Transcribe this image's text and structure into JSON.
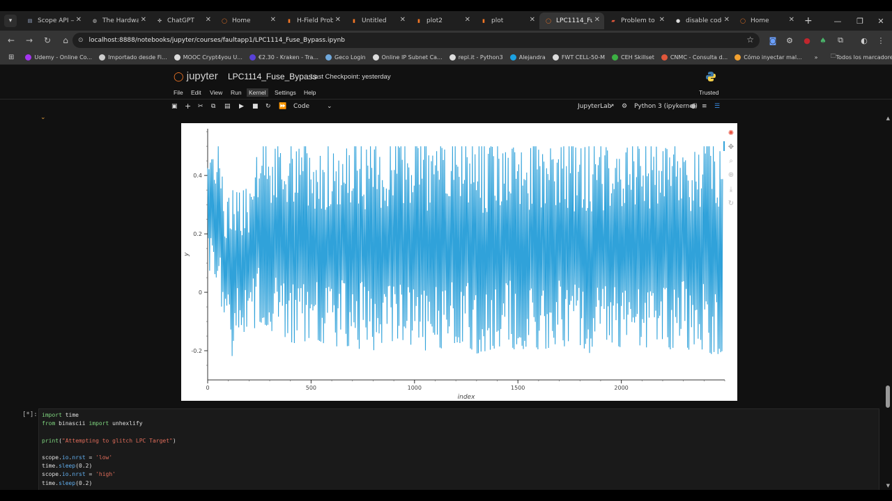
{
  "browser": {
    "tabs": [
      {
        "label": "Scope API —",
        "favicon": "doc-icon",
        "color": "#9aa7c7"
      },
      {
        "label": "The Hardwa",
        "favicon": "globe-icon",
        "color": "#cccccc"
      },
      {
        "label": "ChatGPT",
        "favicon": "chatgpt-icon",
        "color": "#dddddd"
      },
      {
        "label": "Home",
        "favicon": "jupyter-icon",
        "color": "#f37726"
      },
      {
        "label": "H-Field Prob",
        "favicon": "jupyter-book-icon",
        "color": "#f37726"
      },
      {
        "label": "Untitled",
        "favicon": "jupyter-book-icon",
        "color": "#f37726"
      },
      {
        "label": "plot2",
        "favicon": "jupyter-book-icon",
        "color": "#f37726"
      },
      {
        "label": "plot",
        "favicon": "jupyter-book-icon",
        "color": "#f37726"
      },
      {
        "label": "LPC1114_Fu",
        "favicon": "jupyter-icon",
        "color": "#f37726",
        "active": true
      },
      {
        "label": "Problem to",
        "favicon": "mail-icon",
        "color": "#e0573b"
      },
      {
        "label": "disable code",
        "favicon": "github-icon",
        "color": "#dddddd"
      },
      {
        "label": "Home",
        "favicon": "jupyter-icon",
        "color": "#f37726"
      }
    ],
    "url": "localhost:8888/notebooks/jupyter/courses/faultapp1/LPC1114_Fuse_Bypass.ipynb",
    "bookmarks": [
      {
        "label": "Udemy - Online Co...",
        "color": "#a435f0"
      },
      {
        "label": "Importado desde Fi...",
        "color": "#cccccc"
      },
      {
        "label": "MOOC Crypt4you U...",
        "color": "#dddddd"
      },
      {
        "label": "€2.30 - Kraken - Tra...",
        "color": "#5841d8"
      },
      {
        "label": "Geco Login",
        "color": "#6fa8dc"
      },
      {
        "label": "Online IP Subnet Ca...",
        "color": "#dddddd"
      },
      {
        "label": "repl.it - Python3",
        "color": "#dddddd"
      },
      {
        "label": "Alejandra",
        "color": "#1ba1e2"
      },
      {
        "label": "FWT CELL-50-M",
        "color": "#dddddd"
      },
      {
        "label": "CEH Skillset",
        "color": "#3cb043"
      },
      {
        "label": "CNMC - Consulta d...",
        "color": "#e0573b"
      },
      {
        "label": "Cómo inyectar mal...",
        "color": "#f0a030"
      }
    ],
    "all_bookmarks_label": "Todos los marcadores"
  },
  "jupyter": {
    "logo_text": "jupyter",
    "notebook_title": "LPC1114_Fuse_Bypass",
    "checkpoint": "Last Checkpoint: yesterday",
    "menus": [
      "File",
      "Edit",
      "View",
      "Run",
      "Kernel",
      "Settings",
      "Help"
    ],
    "selected_menu": "Kernel",
    "trusted": "Trusted",
    "cell_type": "Code",
    "jupyterlab_label": "JupyterLab",
    "kernel_label": "Python 3 (ipykernel)"
  },
  "cell": {
    "prompt": "[*]:",
    "lines": [
      "import time",
      "from binascii import unhexlify",
      "",
      "print(\"Attempting to glitch LPC Target\")",
      "",
      "scope.io.nrst = 'low'",
      "time.sleep(0.2)",
      "scope.io.nrst = 'high'",
      "time.sleep(0.2)"
    ]
  },
  "chart_data": {
    "type": "line",
    "xlabel": "index",
    "ylabel": "y",
    "xlim": [
      0,
      2500
    ],
    "ylim": [
      -0.3,
      0.56
    ],
    "xticks": [
      0,
      500,
      1000,
      1500,
      2000
    ],
    "yticks": [
      -0.2,
      0,
      0.2,
      0.4
    ],
    "series_color": "#30a2da",
    "series": [
      {
        "description_samples": "dense oscillating trace; sampled envelope values",
        "x": [
          0,
          20,
          40,
          60,
          80,
          100,
          120,
          150,
          200,
          250,
          300,
          350,
          400,
          450,
          500,
          550,
          600,
          650,
          700,
          750,
          800,
          850,
          900,
          950,
          1000,
          1050,
          1100,
          1150,
          1200,
          1250,
          1300,
          1350,
          1400,
          1450,
          1500,
          1550,
          1600,
          1650,
          1700,
          1750,
          1800,
          1850,
          1900,
          1950,
          2000,
          2050,
          2100,
          2150,
          2200,
          2250,
          2300,
          2350,
          2400,
          2450,
          2490
        ],
        "y_max": [
          0.5,
          0.5,
          0.5,
          0.5,
          0.3,
          0.32,
          0.35,
          0.34,
          0.36,
          0.5,
          0.5,
          0.5,
          0.5,
          0.5,
          0.5,
          0.5,
          0.5,
          0.5,
          0.5,
          0.5,
          0.5,
          0.5,
          0.5,
          0.5,
          0.5,
          0.5,
          0.5,
          0.5,
          0.5,
          0.5,
          0.5,
          0.5,
          0.5,
          0.5,
          0.5,
          0.5,
          0.5,
          0.5,
          0.5,
          0.5,
          0.5,
          0.5,
          0.5,
          0.5,
          0.5,
          0.5,
          0.5,
          0.5,
          0.5,
          0.5,
          0.5,
          0.5,
          0.5,
          0.5,
          0.5
        ],
        "y_min": [
          0.05,
          0.1,
          0.05,
          -0.02,
          -0.1,
          -0.08,
          -0.23,
          -0.12,
          -0.15,
          -0.1,
          -0.12,
          -0.18,
          -0.17,
          -0.18,
          -0.15,
          -0.17,
          -0.19,
          -0.18,
          -0.22,
          -0.18,
          -0.2,
          -0.17,
          -0.19,
          -0.16,
          -0.19,
          -0.2,
          -0.18,
          -0.2,
          -0.17,
          -0.18,
          -0.21,
          -0.2,
          -0.19,
          -0.17,
          -0.21,
          -0.18,
          -0.2,
          -0.19,
          -0.17,
          -0.2,
          -0.18,
          -0.21,
          -0.19,
          -0.17,
          -0.19,
          -0.2,
          -0.18,
          -0.2,
          -0.21,
          -0.19,
          -0.17,
          -0.22,
          -0.19,
          -0.22,
          -0.2
        ]
      }
    ]
  }
}
